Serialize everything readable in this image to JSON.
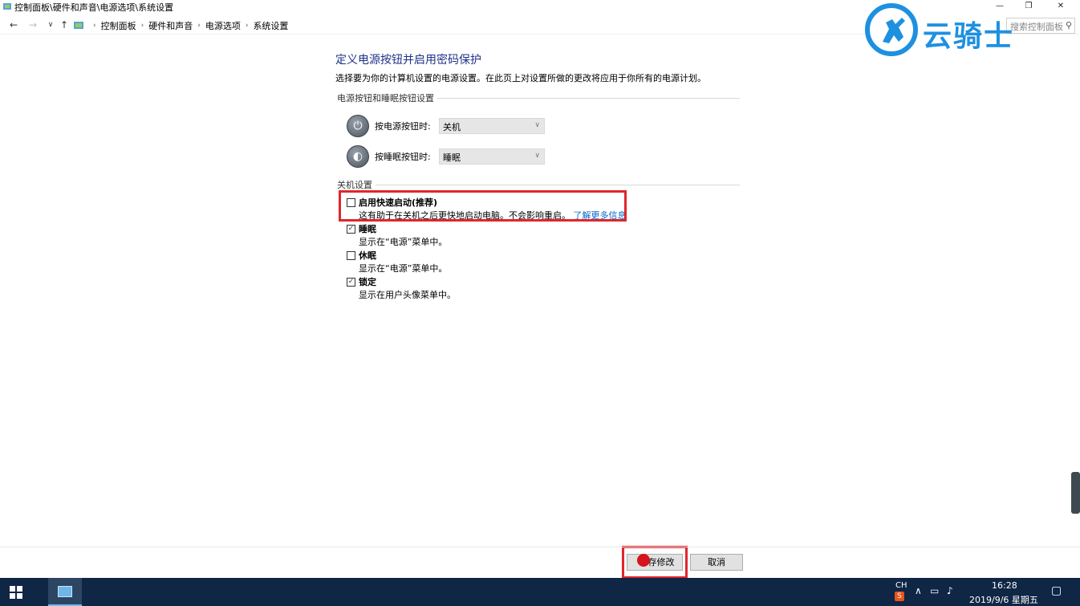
{
  "window": {
    "title": "控制面板\\硬件和声音\\电源选项\\系统设置",
    "minimize": "—",
    "restore": "❐",
    "close": "✕"
  },
  "address": {
    "breadcrumbs": [
      "控制面板",
      "硬件和声音",
      "电源选项",
      "系统设置"
    ],
    "search_placeholder": "搜索控制面板"
  },
  "content": {
    "heading": "定义电源按钮并启用密码保护",
    "description": "选择要为你的计算机设置的电源设置。在此页上对设置所做的更改将应用于你所有的电源计划。",
    "power_group": {
      "title": "电源按钮和睡眠按钮设置",
      "power_button_label": "按电源按钮时:",
      "power_button_value": "关机",
      "sleep_button_label": "按睡眠按钮时:",
      "sleep_button_value": "睡眠"
    },
    "shutdown_group": {
      "title": "关机设置",
      "items": [
        {
          "label": "启用快速启动(推荐)",
          "sub": "这有助于在关机之后更快地启动电脑。不会影响重启。",
          "link": "了解更多信息",
          "checked": false
        },
        {
          "label": "睡眠",
          "sub": "显示在“电源”菜单中。",
          "checked": true
        },
        {
          "label": "休眠",
          "sub": "显示在“电源”菜单中。",
          "checked": false
        },
        {
          "label": "锁定",
          "sub": "显示在用户头像菜单中。",
          "checked": true
        }
      ]
    }
  },
  "buttons": {
    "save": "存修改",
    "cancel": "取消"
  },
  "watermark": {
    "text": "云骑士"
  },
  "taskbar": {
    "ime": "CH",
    "time": "16:28",
    "date": "2019/9/6 星期五"
  },
  "colors": {
    "heading": "#1e3287",
    "link": "#0066cc",
    "highlight": "#e0262d",
    "taskbar": "#0f2645",
    "watermark": "#1e90e0"
  }
}
